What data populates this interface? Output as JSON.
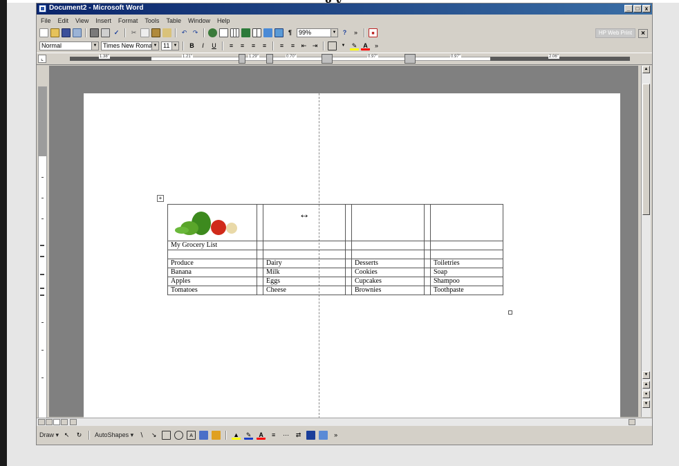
{
  "heading_fragment": "g    y",
  "window": {
    "title": "Document2 - Microsoft Word",
    "buttons": {
      "minimize": "_",
      "maximize": "□",
      "close": "x"
    }
  },
  "menu": [
    "File",
    "Edit",
    "View",
    "Insert",
    "Format",
    "Tools",
    "Table",
    "Window",
    "Help"
  ],
  "toolbar": {
    "zoom": "99%",
    "style": "Normal",
    "font": "Times New Roman",
    "size": "11"
  },
  "hp_panel": "HP Web Print",
  "ruler": {
    "labels": [
      "1.38\"",
      "1.21\"",
      "1.29\"",
      "0.70\"",
      "0.97\"",
      "0.97\"",
      "2.06\""
    ]
  },
  "table": {
    "title": "My Grocery List",
    "headers": [
      "Produce",
      "Dairy",
      "Desserts",
      "Toiletries"
    ],
    "rows": [
      [
        "Banana",
        "Milk",
        "Cookies",
        "Soap"
      ],
      [
        "Apples",
        "Eggs",
        "Cupcakes",
        "Shampoo"
      ],
      [
        "Tomatoes",
        "Cheese",
        "Brownies",
        "Toothpaste"
      ]
    ]
  },
  "drawbar": {
    "draw_label": "Draw ▾",
    "autoshapes_label": "AutoShapes ▾"
  },
  "colors": {
    "titlebar_start": "#0a246a",
    "titlebar_end": "#3a6ea5",
    "chrome": "#d4d0c8",
    "workspace": "#808080"
  },
  "icons": [
    "new-document-icon",
    "open-icon",
    "save-icon",
    "print-icon",
    "print-preview-icon",
    "spell-check-icon",
    "cut-icon",
    "copy-icon",
    "paste-icon",
    "undo-icon",
    "redo-icon",
    "table-icon",
    "columns-icon",
    "drawing-icon",
    "show-hide-icon",
    "bold-icon",
    "italic-icon",
    "underline-icon",
    "align-left-icon",
    "center-icon",
    "align-right-icon",
    "justify-icon",
    "numbering-icon",
    "bullets-icon",
    "outdent-icon",
    "indent-icon",
    "border-icon",
    "highlight-icon",
    "font-color-icon"
  ]
}
